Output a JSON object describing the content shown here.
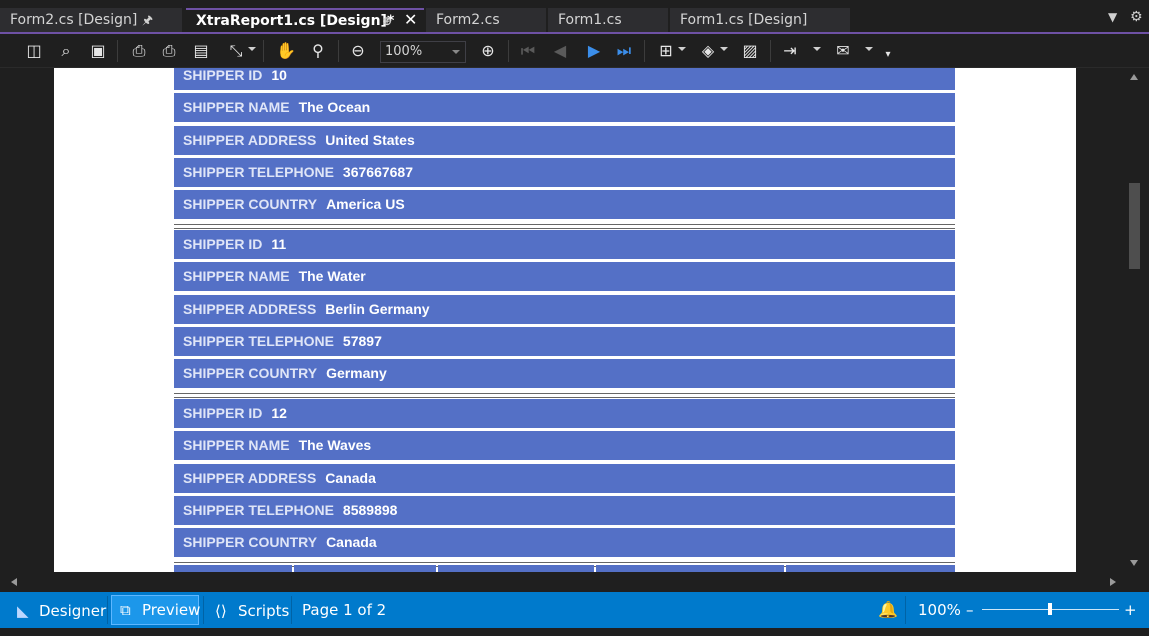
{
  "tabs": [
    {
      "label": "Form2.cs [Design]"
    },
    {
      "label": "XtraReport1.cs [Design]*"
    },
    {
      "label": "Form2.cs"
    },
    {
      "label": "Form1.cs"
    },
    {
      "label": "Form1.cs [Design]"
    }
  ],
  "toolbar": {
    "zoom_value": "100%"
  },
  "report": {
    "records": [
      {
        "fields": [
          {
            "label": "SHIPPER ID",
            "value": "10"
          },
          {
            "label": "SHIPPER NAME",
            "value": "The Ocean"
          },
          {
            "label": "SHIPPER ADDRESS",
            "value": "United States"
          },
          {
            "label": "SHIPPER TELEPHONE",
            "value": "367667687"
          },
          {
            "label": "SHIPPER COUNTRY",
            "value": "America US"
          }
        ]
      },
      {
        "fields": [
          {
            "label": "SHIPPER ID",
            "value": "11"
          },
          {
            "label": "SHIPPER NAME",
            "value": "The Water"
          },
          {
            "label": "SHIPPER ADDRESS",
            "value": "Berlin Germany"
          },
          {
            "label": "SHIPPER TELEPHONE",
            "value": "57897"
          },
          {
            "label": "SHIPPER COUNTRY",
            "value": "Germany"
          }
        ]
      },
      {
        "fields": [
          {
            "label": "SHIPPER ID",
            "value": "12"
          },
          {
            "label": "SHIPPER NAME",
            "value": "The Waves"
          },
          {
            "label": "SHIPPER ADDRESS",
            "value": "Canada"
          },
          {
            "label": "SHIPPER TELEPHONE",
            "value": "8589898"
          },
          {
            "label": "SHIPPER COUNTRY",
            "value": "Canada"
          }
        ]
      }
    ]
  },
  "statusbar": {
    "designer_label": "Designer",
    "preview_label": "Preview",
    "scripts_label": "Scripts",
    "page_info": "Page 1 of 2",
    "zoom": "100%",
    "zoom_minus": "–",
    "zoom_plus": "+"
  },
  "colors": {
    "accent": "#6e51a5",
    "status_bar": "#007acc",
    "report_band": "#5470c6"
  },
  "icons": [
    "layout-icon",
    "find-icon",
    "save-icon",
    "print-icon",
    "quick-print-icon",
    "page-setup-icon",
    "scale-icon",
    "hand-tool-icon",
    "magnifier-icon",
    "zoom-out-icon",
    "zoom-in-icon",
    "first-page-icon",
    "previous-page-icon",
    "next-page-icon",
    "last-page-icon",
    "multiple-pages-icon",
    "background-color-icon",
    "watermark-icon",
    "export-icon",
    "email-icon",
    "notification-bell-icon"
  ]
}
